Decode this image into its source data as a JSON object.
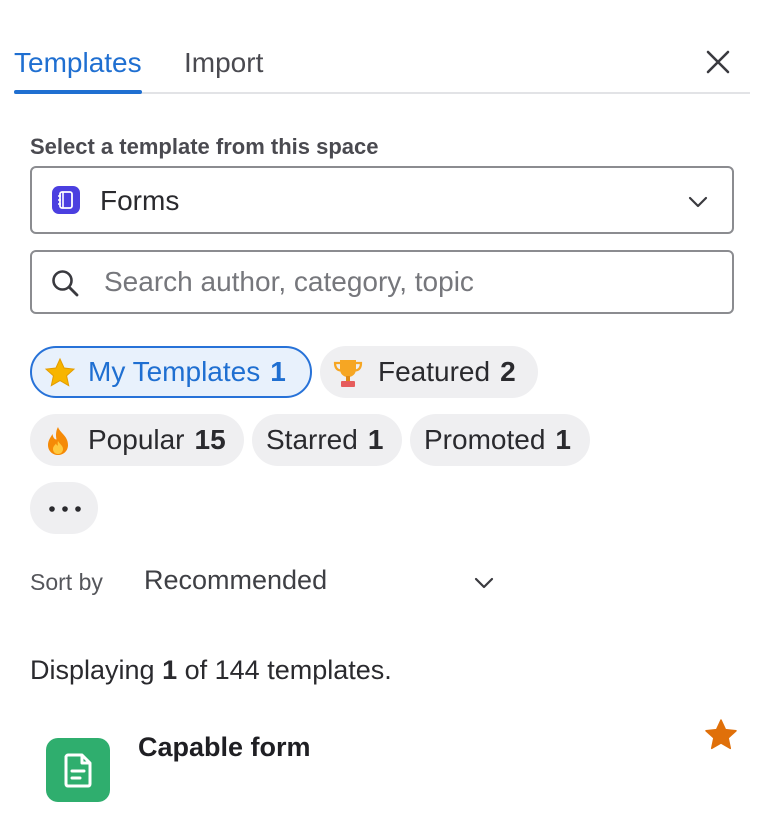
{
  "tabs": [
    {
      "label": "Templates",
      "active": true
    },
    {
      "label": "Import",
      "active": false
    }
  ],
  "close_icon": "close-icon",
  "space_select": {
    "label": "Select a template from this space",
    "value": "Forms",
    "icon": "forms-space-icon",
    "icon_color": "#4b3fe0"
  },
  "search": {
    "placeholder": "Search author, category, topic",
    "value": ""
  },
  "filters": [
    {
      "label": "My Templates",
      "count": "1",
      "icon": "star-icon",
      "active": true
    },
    {
      "label": "Featured",
      "count": "2",
      "icon": "trophy-icon",
      "active": false
    },
    {
      "label": "Popular",
      "count": "15",
      "icon": "fire-icon",
      "active": false
    },
    {
      "label": "Starred",
      "count": "1",
      "icon": "",
      "active": false
    },
    {
      "label": "Promoted",
      "count": "1",
      "icon": "",
      "active": false
    }
  ],
  "more_filters_icon": "more-horizontal-icon",
  "sort": {
    "label": "Sort by",
    "value": "Recommended"
  },
  "results": {
    "prefix": "Displaying",
    "shown": "1",
    "middle": "of 144 templates."
  },
  "templates": [
    {
      "title": "Capable form",
      "icon": "form-document-icon",
      "icon_color": "#2fae6e",
      "starred": true
    }
  ],
  "colors": {
    "accent": "#1f6fd1",
    "chip_bg": "#efeff1",
    "active_chip_bg": "#e8f1fc",
    "star": "#e0700a"
  }
}
